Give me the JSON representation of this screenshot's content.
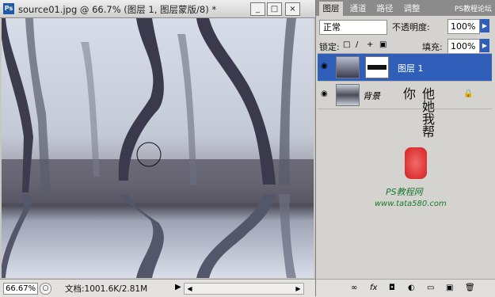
{
  "document": {
    "title": "source01.jpg @ 66.7% (图层 1, 图层蒙版/8) *",
    "ps_logo": "Ps",
    "buttons": {
      "minimize": "_",
      "restore": "□",
      "close": "×"
    }
  },
  "status": {
    "zoom": "66.67%",
    "doc_info": "文档:1001.6K/2.81M",
    "arrow": "▶"
  },
  "panel": {
    "tabs": [
      "图层",
      "通道",
      "路径",
      "调整"
    ],
    "watermark": "PS教程论坛",
    "blend_mode": "正常",
    "opacity_label": "不透明度:",
    "opacity_value": "100%",
    "lock_label": "锁定:",
    "fill_label": "填充:",
    "fill_value": "100%",
    "layers": [
      {
        "name": "图层 1",
        "selected": true
      },
      {
        "name": "背景",
        "selected": false
      }
    ],
    "watermark_text": "他她我帮你",
    "watermark_site_cn": "PS教程网",
    "watermark_url": "www.tata580.com"
  },
  "icons": [
    "ps-logo-icon",
    "eye-icon",
    "lock-icon",
    "chain-icon",
    "fx-icon",
    "mask-icon",
    "adjustment-icon",
    "folder-icon",
    "new-layer-icon",
    "trash-icon",
    "brush-cursor-icon"
  ]
}
